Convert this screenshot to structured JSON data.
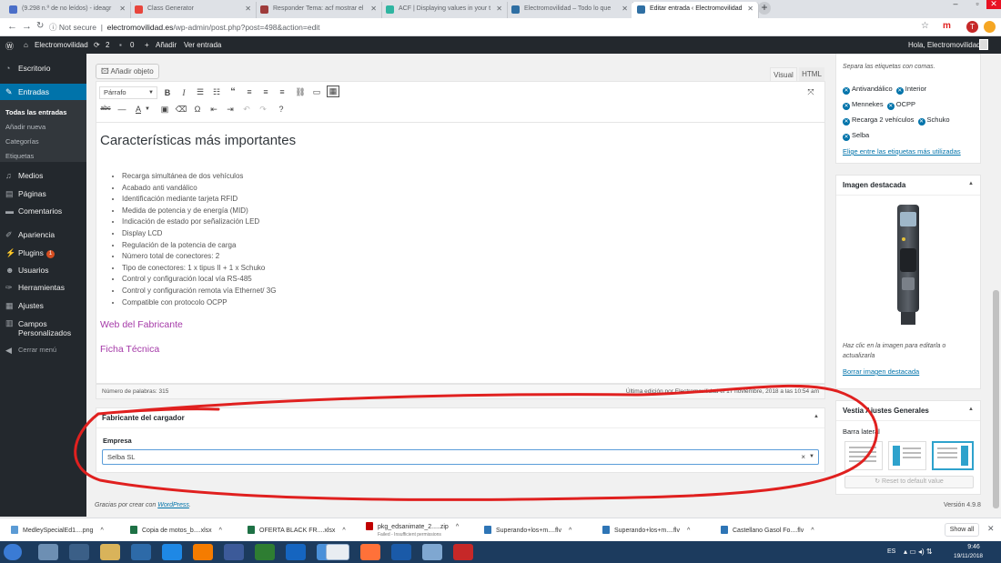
{
  "browser": {
    "tabs": [
      {
        "title": "(9.298 n.º de no leídos) - ideagr",
        "icon": "mail-icon",
        "color": "#4a6ec8"
      },
      {
        "title": "Class Generator",
        "icon": "bolt-icon",
        "color": "#e8453c"
      },
      {
        "title": "Responder Tema: acf mostrar el",
        "icon": "wp-icon",
        "color": "#9e3b3b"
      },
      {
        "title": "ACF | Displaying values in your t",
        "icon": "acf-icon",
        "color": "#2fb5a1"
      },
      {
        "title": "Electromovilidad – Todo lo que",
        "icon": "gear-icon",
        "color": "#2f6fa3"
      },
      {
        "title": "Editar entrada ‹ Electromovilidad",
        "icon": "gear-icon",
        "color": "#2f6fa3"
      }
    ],
    "not_secure": "Not secure",
    "url_domain": "electromovilidad.es",
    "url_path": "/wp-admin/post.php?post=498&action=edit",
    "profile_initial": "T"
  },
  "adminbar": {
    "site_name": "Electromovilidad",
    "updates": "2",
    "comments": "0",
    "new_label": "Añadir",
    "view_label": "Ver entrada",
    "greeting": "Hola, Electromovilidad"
  },
  "sidebar": {
    "items": [
      {
        "label": "Escritorio",
        "icon": "dashboard-icon"
      },
      {
        "label": "Entradas",
        "icon": "pin-icon"
      },
      {
        "label": "Medios",
        "icon": "media-icon"
      },
      {
        "label": "Páginas",
        "icon": "page-icon"
      },
      {
        "label": "Comentarios",
        "icon": "comment-icon"
      },
      {
        "label": "Apariencia",
        "icon": "brush-icon"
      },
      {
        "label": "Plugins",
        "icon": "plugin-icon",
        "badge": "1"
      },
      {
        "label": "Usuarios",
        "icon": "user-icon"
      },
      {
        "label": "Herramientas",
        "icon": "wrench-icon"
      },
      {
        "label": "Ajustes",
        "icon": "settings-icon"
      },
      {
        "label": "Campos Personalizados",
        "icon": "fields-icon"
      },
      {
        "label": "Cerrar menú",
        "icon": "collapse-icon"
      }
    ],
    "subitems": [
      "Todas las entradas",
      "Añadir nueva",
      "Categorías",
      "Etiquetas"
    ]
  },
  "editor": {
    "add_media": "Añadir objeto",
    "tab_visual": "Visual",
    "tab_html": "HTML",
    "format_select": "Párrafo",
    "heading": "Características más importantes",
    "features": [
      "Recarga simultánea de dos vehículos",
      "Acabado anti vandálico",
      "Identificación mediante tarjeta RFID",
      "Medida de potencia y de energía (MID)",
      "Indicación de estado por señalización LED",
      "Display LCD",
      "Regulación de la potencia de carga",
      "Número total de conectores: 2",
      "Tipo de conectores: 1 x tipus II + 1 x Schuko",
      "Control y configuración local vía RS-485",
      "Control y configuración remota vía Ethernet/ 3G",
      "Compatible con protocolo OCPP"
    ],
    "link1": "Web del Fabricante",
    "link2": "Ficha Técnica",
    "word_count": "Número de palabras: 315",
    "last_edit": "Última edición por Electromovilidad el 17 noviembre, 2018 a las 10:54 am"
  },
  "metabox": {
    "title": "Fabricante del cargador",
    "field_label": "Empresa",
    "field_value": "Selba SL"
  },
  "footer": {
    "thanks_prefix": "Gracias por crear con ",
    "thanks_link": "WordPress",
    "thanks_suffix": ".",
    "version": "Versión 4.9.8"
  },
  "tags": {
    "hint": "Separa las etiquetas con comas.",
    "items": [
      "Antivandálico",
      "Interior",
      "Mennekes",
      "OCPP",
      "Recarga 2 vehículos",
      "Schuko",
      "Selba"
    ],
    "most_used": "Elige entre las etiquetas más utilizadas"
  },
  "featured": {
    "title": "Imagen destacada",
    "hint": "Haz clic en la imagen para editarla o actualizarla",
    "remove": "Borrar imagen destacada"
  },
  "theme_settings": {
    "title": "Vestia Ajustes Generales",
    "label": "Barra lateral",
    "reset": "Reset to default value"
  },
  "annotation": {
    "color": "#e0201f"
  },
  "downloads": {
    "items": [
      {
        "name": "MedleySpecialEd1....png",
        "icon": "image-file-icon",
        "color": "#5b9bd5"
      },
      {
        "name": "Copia de motos_b....xlsx",
        "icon": "excel-file-icon",
        "color": "#1e7145"
      },
      {
        "name": "OFERTA BLACK FR....xlsx",
        "icon": "excel-file-icon",
        "color": "#1e7145"
      },
      {
        "name": "pkg_edsanimate_2.....zip",
        "sub": "Failed - Insufficient permissions",
        "icon": "zip-file-icon",
        "color": "#c00000"
      },
      {
        "name": "Superando+los+m....flv",
        "icon": "video-file-icon",
        "color": "#2e75b6"
      },
      {
        "name": "Superando+los+m....flv",
        "icon": "video-file-icon",
        "color": "#2e75b6"
      },
      {
        "name": "Castellano Gasol Fo....flv",
        "icon": "video-file-icon",
        "color": "#2e75b6"
      }
    ],
    "show_all": "Show all"
  },
  "taskbar": {
    "lang": "ES",
    "time": "9:46",
    "date": "19/11/2018"
  }
}
